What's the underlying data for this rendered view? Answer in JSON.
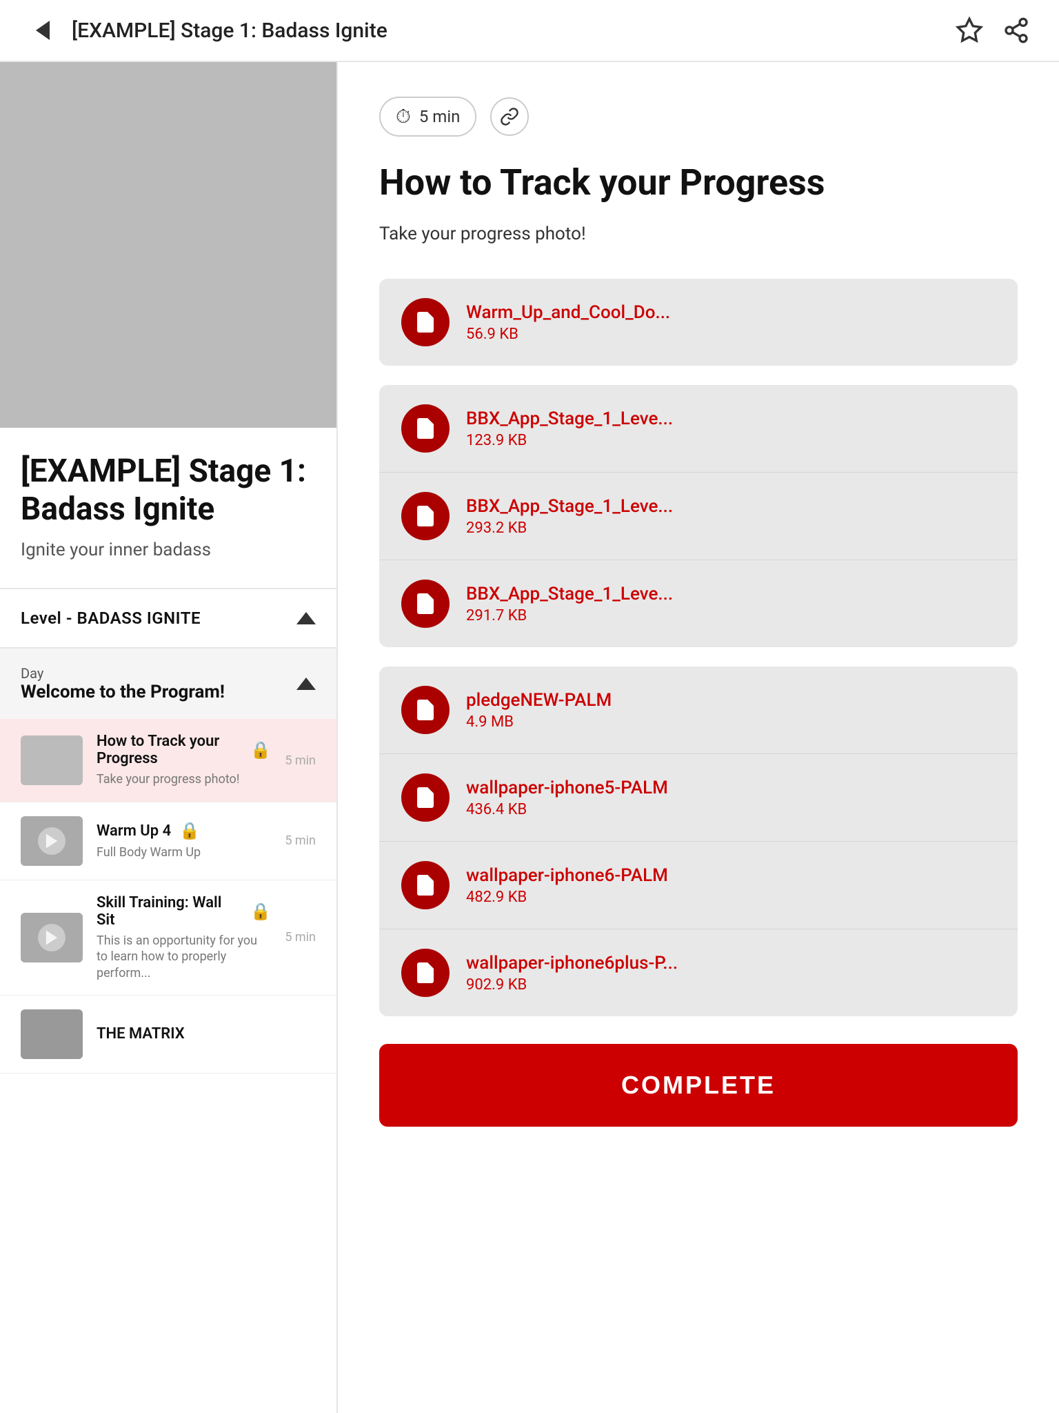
{
  "header": {
    "title": "[EXAMPLE] Stage 1: Badass Ignite",
    "back_label": "Back"
  },
  "program": {
    "title": "[EXAMPLE] Stage 1: Badass Ignite",
    "subtitle": "Ignite your inner badass",
    "level_label": "Level - BADASS IGNITE",
    "day_label": "Day",
    "day_name": "Welcome to the Program!"
  },
  "lessons": [
    {
      "title": "How to Track your Progress",
      "desc": "Take your progress photo!",
      "duration": "5 min",
      "active": true,
      "locked": true
    },
    {
      "title": "Warm Up 4",
      "desc": "Full Body Warm Up",
      "duration": "5 min",
      "active": false,
      "locked": true
    },
    {
      "title": "Skill Training: Wall Sit",
      "desc": "This is an opportunity for you to learn how to properly perform...",
      "duration": "5 min",
      "active": false,
      "locked": true
    },
    {
      "title": "THE MATRIX",
      "desc": "",
      "duration": "",
      "active": false,
      "locked": false
    }
  ],
  "content": {
    "duration": "5 min",
    "title": "How to Track your Progress",
    "description": "Take your progress photo!",
    "complete_label": "COMPLETE"
  },
  "file_groups": [
    {
      "files": [
        {
          "name": "Warm_Up_and_Cool_Do...",
          "size": "56.9 KB"
        }
      ]
    },
    {
      "files": [
        {
          "name": "BBX_App_Stage_1_Leve...",
          "size": "123.9 KB"
        },
        {
          "name": "BBX_App_Stage_1_Leve...",
          "size": "293.2 KB"
        },
        {
          "name": "BBX_App_Stage_1_Leve...",
          "size": "291.7 KB"
        }
      ]
    },
    {
      "files": [
        {
          "name": "pledgeNEW-PALM",
          "size": "4.9 MB"
        },
        {
          "name": "wallpaper-iphone5-PALM",
          "size": "436.4 KB"
        },
        {
          "name": "wallpaper-iphone6-PALM",
          "size": "482.9 KB"
        },
        {
          "name": "wallpaper-iphone6plus-P...",
          "size": "902.9 KB"
        }
      ]
    }
  ]
}
